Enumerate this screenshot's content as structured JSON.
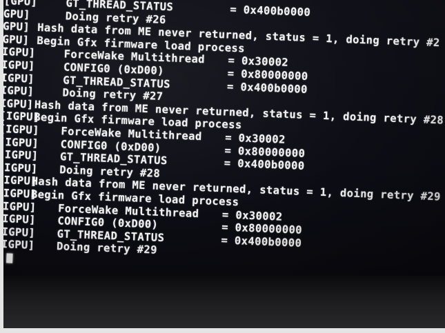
{
  "console": {
    "lines": [
      {
        "kind": "field",
        "tag": "[GPU]",
        "label": "GT_THREAD_STATUS",
        "value": "= 0x400b0000"
      },
      {
        "kind": "retry",
        "tag": "GPU]",
        "label": "Doing retry #26"
      },
      {
        "kind": "msg",
        "tag": "GPU]",
        "msg": "Hash data from ME never returned, status = 1, doing retry #2"
      },
      {
        "kind": "msg",
        "tag": "GPU]",
        "msg": "Begin Gfx firmware load process"
      },
      {
        "kind": "field",
        "tag": "IGPU]",
        "label": "ForceWake Multithread",
        "value": "= 0x30002"
      },
      {
        "kind": "field",
        "tag": "IGPU]",
        "label": "CONFIG0 (0xD00)",
        "value": "= 0x80000000"
      },
      {
        "kind": "field",
        "tag": "IGPU]",
        "label": "GT_THREAD_STATUS",
        "value": "= 0x400b0000"
      },
      {
        "kind": "retry",
        "tag": "IGPU]",
        "label": "Doing retry #27"
      },
      {
        "kind": "msg",
        "tag": "IGPU]",
        "msg": "Hash data from ME never returned, status = 1, doing retry #28"
      },
      {
        "kind": "msg",
        "tag": "[IGPU]",
        "msg": "Begin Gfx firmware load process"
      },
      {
        "kind": "field",
        "tag": "[IGPU]",
        "label": "ForceWake Multithread",
        "value": "= 0x30002"
      },
      {
        "kind": "field",
        "tag": "[IGPU]",
        "label": "CONFIG0 (0xD00)",
        "value": "= 0x80000000"
      },
      {
        "kind": "field",
        "tag": "[IGPU]",
        "label": "GT_THREAD_STATUS",
        "value": "= 0x400b0000"
      },
      {
        "kind": "retry",
        "tag": "[IGPU]",
        "label": "Doing retry #28"
      },
      {
        "kind": "msg",
        "tag": "[IGPU]",
        "msg": "Hash data from ME never returned, status = 1, doing retry #29"
      },
      {
        "kind": "msg",
        "tag": "[IGPU]",
        "msg": "Begin Gfx firmware load process"
      },
      {
        "kind": "field",
        "tag": "[IGPU]",
        "label": "ForceWake Multithread",
        "value": "= 0x30002"
      },
      {
        "kind": "field",
        "tag": "[IGPU]",
        "label": "CONFIG0 (0xD00)",
        "value": "= 0x80000000"
      },
      {
        "kind": "field",
        "tag": "[IGPU]",
        "label": "GT_THREAD_STATUS",
        "value": "= 0x400b0000"
      },
      {
        "kind": "retry",
        "tag": "[IGPU]",
        "label": "Doing retry #29"
      }
    ]
  }
}
